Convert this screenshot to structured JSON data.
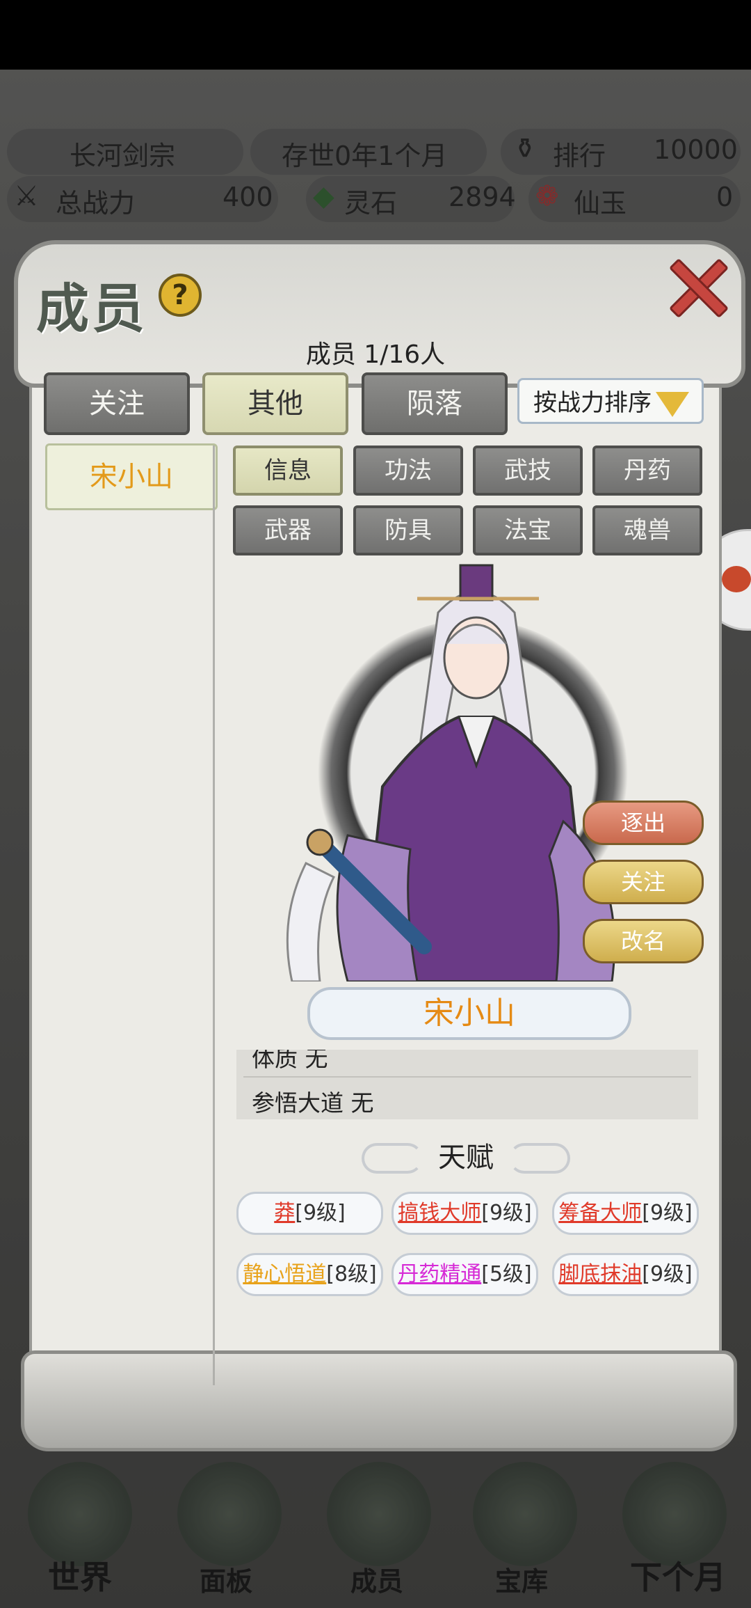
{
  "hud": {
    "sect_name": "长河剑宗",
    "age": "存世0年1个月",
    "rank_label": "排行",
    "rank_value": "10000",
    "power_label": "总战力",
    "power_value": "400",
    "spirit_stone_label": "灵石",
    "spirit_stone_value": "2894",
    "jade_label": "仙玉",
    "jade_value": "0"
  },
  "panel": {
    "title": "成员",
    "help": "?",
    "member_count": "成员  1/16人",
    "tabs": [
      "关注",
      "其他",
      "陨落"
    ],
    "active_tab": "其他",
    "sort_label": "按战力排序"
  },
  "members": [
    "宋小山"
  ],
  "subtabs": [
    "信息",
    "功法",
    "武技",
    "丹药",
    "武器",
    "防具",
    "法宝",
    "魂兽"
  ],
  "active_subtab": "信息",
  "actions": [
    "逐出",
    "关注",
    "改名"
  ],
  "character_name": "宋小山",
  "info_rows": [
    "体质 无",
    "参悟大道 无"
  ],
  "talent_header": "天赋",
  "talents": [
    {
      "name": "莽",
      "level": "[9级]",
      "color": "#e03a2a"
    },
    {
      "name": "搞钱大师",
      "level": "[9级]",
      "color": "#e03a2a"
    },
    {
      "name": "筹备大师",
      "level": "[9级]",
      "color": "#e03a2a"
    },
    {
      "name": "静心悟道",
      "level": "[8级]",
      "color": "#e8a21a"
    },
    {
      "name": "丹药精通",
      "level": "[5级]",
      "color": "#d62ad6"
    },
    {
      "name": "脚底抹油",
      "level": "[9级]",
      "color": "#e03a2a"
    }
  ],
  "bottom_nav": [
    "世界",
    "面板",
    "成员",
    "宝库",
    "下个月"
  ]
}
